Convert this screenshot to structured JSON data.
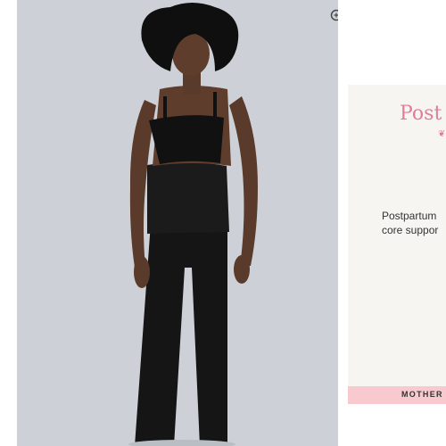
{
  "gallery": {
    "image_alt": "Model wearing black high-waist postpartum leggings and black bralette",
    "zoom_icon": "zoom-in-icon",
    "background": "#cdd1d7"
  },
  "panel": {
    "title": "Post",
    "description_lines": [
      "Postpartum",
      "core suppor"
    ],
    "strip_label": "MOTHER",
    "title_color": "#e27b9a",
    "strip_color": "#f8c9cf"
  }
}
